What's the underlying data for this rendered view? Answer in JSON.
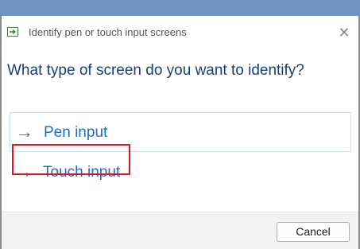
{
  "window": {
    "title": "Identify pen or touch input screens",
    "close_glyph": "✕",
    "title_icon": "identify-screen-icon"
  },
  "main": {
    "heading": "What type of screen do you want to identify?",
    "options": [
      {
        "label": "Pen input",
        "icon": "arrow-right-icon",
        "arrow": "→"
      },
      {
        "label": "Touch input",
        "icon": "arrow-right-icon",
        "arrow": "→",
        "highlighted": true
      }
    ]
  },
  "footer": {
    "cancel_label": "Cancel"
  },
  "colors": {
    "accent": "#1f6fc0",
    "heading": "#1a3f7a",
    "highlight": "#e0141e",
    "title_strip": "#6f93c2"
  }
}
